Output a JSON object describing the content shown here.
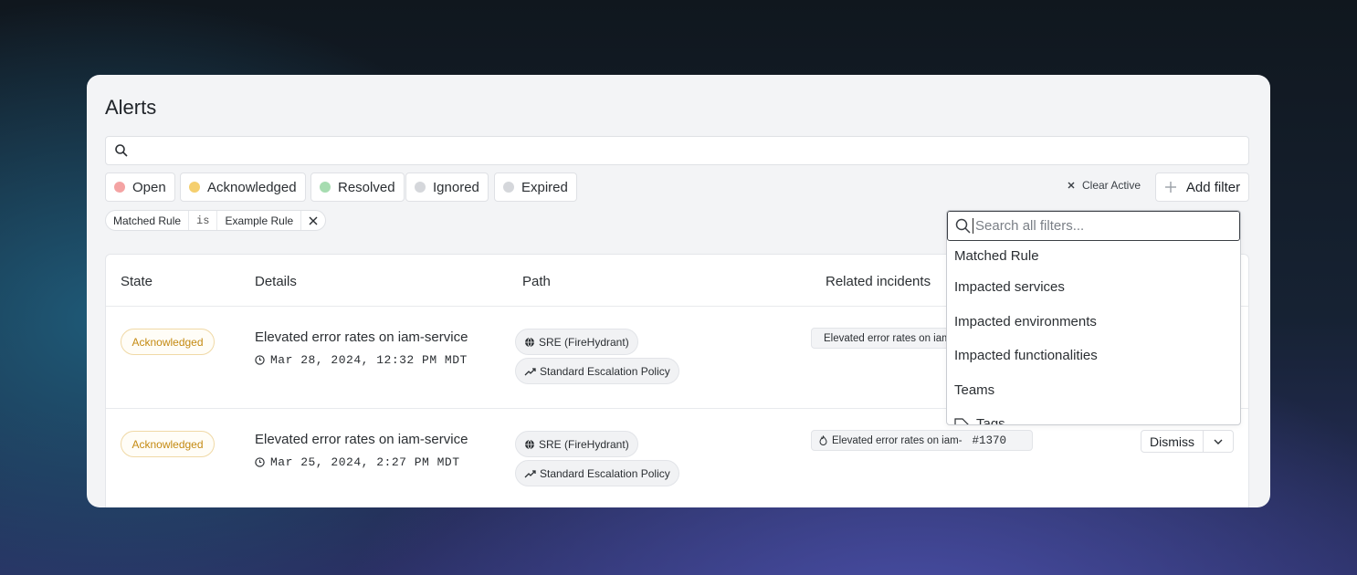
{
  "page": {
    "title": "Alerts"
  },
  "search": {
    "placeholder": ""
  },
  "status_filters": [
    {
      "label": "Open",
      "color": "#f4a3a3"
    },
    {
      "label": "Acknowledged",
      "color": "#f5cf6e"
    },
    {
      "label": "Resolved",
      "color": "#a6dcb0"
    },
    {
      "label": "Ignored",
      "color": "#d5d7db"
    },
    {
      "label": "Expired",
      "color": "#d5d7db"
    }
  ],
  "toolbar": {
    "clear_active_label": "Clear Active",
    "add_filter_label": "Add filter"
  },
  "active_filter": {
    "field": "Matched Rule",
    "operator": "is",
    "value": "Example Rule"
  },
  "table": {
    "headers": [
      "State",
      "Details",
      "Path",
      "Related incidents"
    ],
    "rows": [
      {
        "state": "Acknowledged",
        "title": "Elevated error rates on iam-service",
        "time": "Mar 28, 2024, 12:32 PM MDT",
        "path": [
          "SRE (FireHydrant)",
          "Standard Escalation Policy"
        ],
        "incident": "Elevated error rates on iam-service",
        "incident_number": ""
      },
      {
        "state": "Acknowledged",
        "title": "Elevated error rates on iam-service",
        "time": "Mar 25, 2024, 2:27 PM MDT",
        "path": [
          "SRE (FireHydrant)",
          "Standard Escalation Policy"
        ],
        "incident": "Elevated error rates on iam-",
        "incident_number": "#1370",
        "action": "Dismiss"
      }
    ]
  },
  "filter_dropdown": {
    "placeholder": "Search all filters...",
    "items": [
      "Matched Rule",
      "Impacted services",
      "Impacted environments",
      "Impacted functionalities",
      "Teams",
      "Tags"
    ]
  }
}
